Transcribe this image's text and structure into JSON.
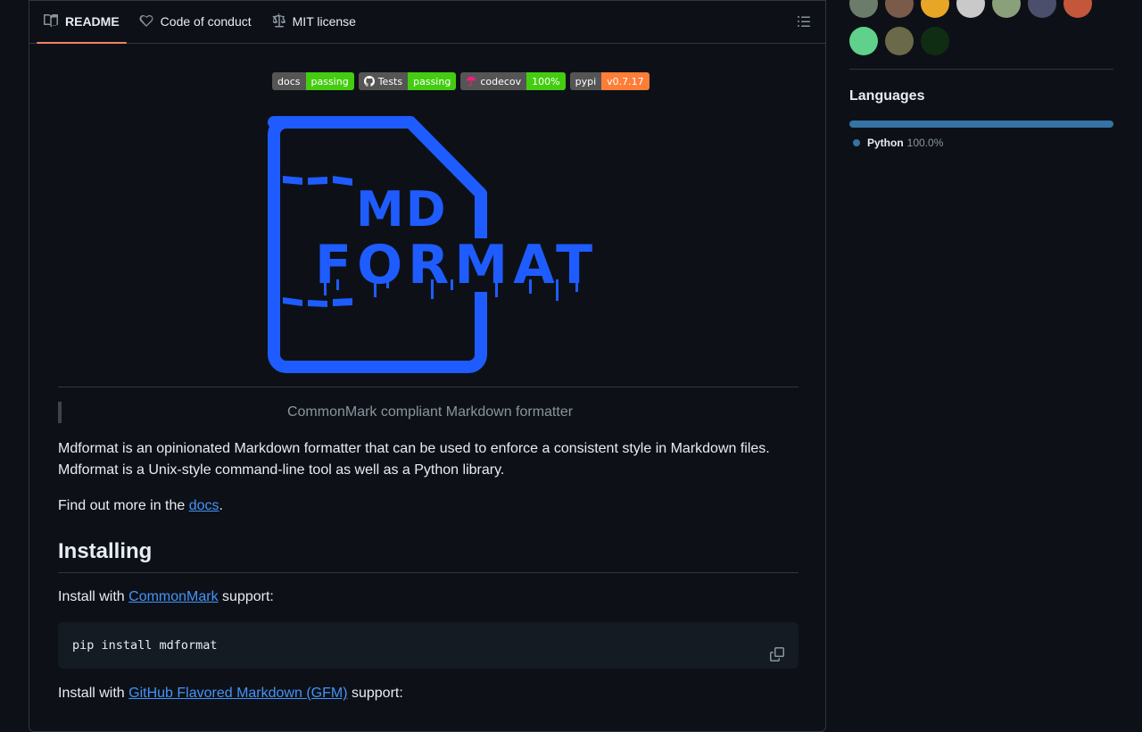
{
  "tabs": {
    "readme": "README",
    "conduct": "Code of conduct",
    "license": "MIT license"
  },
  "badges": [
    {
      "left": "docs",
      "right": "passing",
      "color": "#4c1"
    },
    {
      "left": "Tests",
      "right": "passing",
      "color": "#4c1"
    },
    {
      "left": "codecov",
      "right": "100%",
      "color": "#4c1"
    },
    {
      "left": "pypi",
      "right": "v0.7.17",
      "color": "#fe7d37"
    }
  ],
  "logo": {
    "line1": "MD",
    "line2": "FORMAT",
    "color": "#1f5cff"
  },
  "readme": {
    "tagline": "CommonMark compliant Markdown formatter",
    "intro_line1": "Mdformat is an opinionated Markdown formatter that can be used to enforce a consistent style in Markdown files.",
    "intro_line2": "Mdformat is a Unix-style command-line tool as well as a Python library.",
    "docs_prefix": "Find out more in the ",
    "docs_link": "docs",
    "docs_suffix": ".",
    "installing_heading": "Installing",
    "install1_prefix": "Install with ",
    "install1_link": "CommonMark",
    "install1_suffix": " support:",
    "code1": "pip install mdformat",
    "install2_prefix": "Install with ",
    "install2_link": "GitHub Flavored Markdown (GFM)",
    "install2_suffix": " support:"
  },
  "sidebar": {
    "languages_title": "Languages",
    "languages": [
      {
        "name": "Python",
        "percent": "100.0%",
        "color": "#3572A5"
      }
    ],
    "contributors": [
      {
        "name": "contributor-avatar",
        "color": "#6b7d6a"
      },
      {
        "name": "contributor-avatar",
        "color": "#7a5a48"
      },
      {
        "name": "contributor-avatar",
        "color": "#e8a626"
      },
      {
        "name": "contributor-avatar",
        "color": "#c9c9c9"
      },
      {
        "name": "contributor-avatar",
        "color": "#8aa07a"
      },
      {
        "name": "contributor-avatar",
        "color": "#4b4f6b"
      },
      {
        "name": "contributor-avatar",
        "color": "#c4573a"
      },
      {
        "name": "contributor-avatar",
        "color": "#5fd18a"
      },
      {
        "name": "contributor-avatar",
        "color": "#6a6a4a"
      },
      {
        "name": "contributor-avatar",
        "color": "#0f2d12"
      }
    ]
  }
}
